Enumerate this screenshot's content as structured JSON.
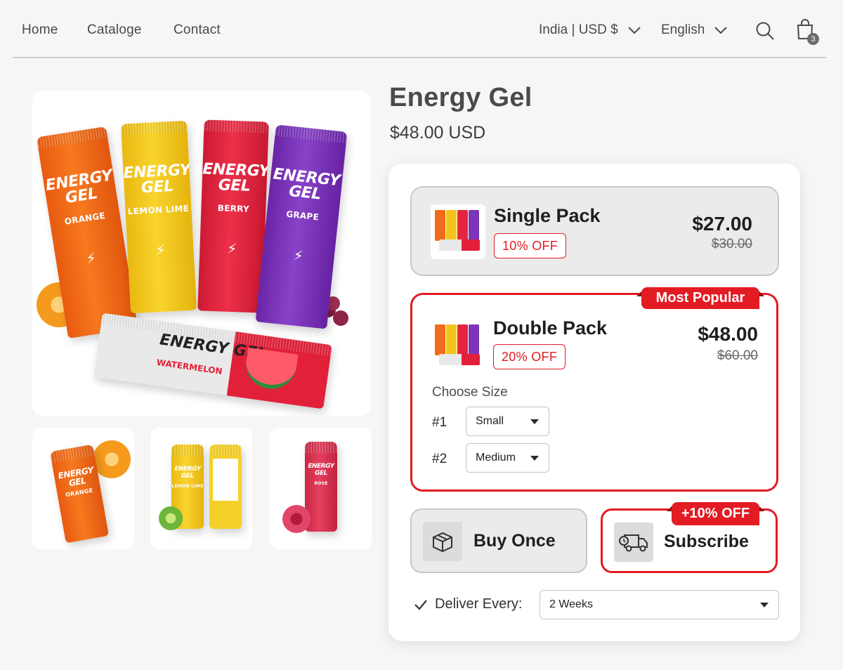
{
  "nav": {
    "links": [
      "Home",
      "Cataloge",
      "Contact"
    ],
    "region": "India | USD $",
    "language": "English",
    "cart_count": "3"
  },
  "product": {
    "title": "Energy Gel",
    "price": "$48.00 USD"
  },
  "gallery": {
    "main_packs": [
      {
        "brand": "ENERGY GEL",
        "flavor": "ORANGE",
        "color": "#f26a1b"
      },
      {
        "brand": "ENERGY GEL",
        "flavor": "LEMON LIME",
        "color": "#f3c51c"
      },
      {
        "brand": "ENERGY GEL",
        "flavor": "BERRY",
        "color": "#e3263f"
      },
      {
        "brand": "ENERGY GEL",
        "flavor": "GRAPE",
        "color": "#7b35b8"
      }
    ],
    "main_bar": {
      "brand": "ENERGY GEL",
      "flavor": "WATERMELON"
    },
    "thumbs": [
      {
        "brand": "ENERGY GEL",
        "flavor": "ORANGE",
        "color": "#f26a1b"
      },
      {
        "brand": "ENERGY GEL",
        "flavor": "LEMON LIME",
        "color": "#f3c51c"
      },
      {
        "brand": "ENERGY GEL",
        "flavor": "ROSE",
        "color": "#d9324f"
      }
    ]
  },
  "options": {
    "single": {
      "name": "Single Pack",
      "discount": "10% OFF",
      "price": "$27.00",
      "compare": "$30.00"
    },
    "double": {
      "badge": "Most Popular",
      "name": "Double Pack",
      "discount": "20% OFF",
      "price": "$48.00",
      "compare": "$60.00",
      "choose_size": "Choose Size",
      "sizes": [
        {
          "num": "#1",
          "value": "Small"
        },
        {
          "num": "#2",
          "value": "Medium"
        }
      ]
    }
  },
  "purchase": {
    "buy_once": "Buy Once",
    "subscribe": "Subscribe",
    "subscribe_badge": "+10% OFF",
    "deliver_label": "Deliver Every:",
    "deliver_value": "2 Weeks"
  },
  "colors": {
    "accent": "#e31b23",
    "selected_bg": "#ebebeb"
  }
}
